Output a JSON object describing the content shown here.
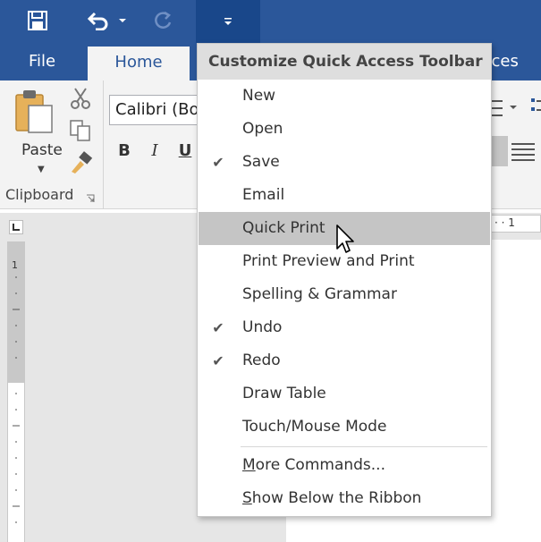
{
  "qat": {
    "save_icon": "save-icon",
    "undo_icon": "undo-icon",
    "redo_icon": "redo-icon",
    "customize_icon": "customize-dropdown-icon"
  },
  "tabs": {
    "file": "File",
    "home": "Home",
    "references_partial": "rences"
  },
  "ribbon": {
    "paste_label": "Paste",
    "clipboard_label": "Clipboard",
    "font_name": "Calibri (Bod",
    "bold": "B",
    "italic": "I",
    "underline": "U"
  },
  "ruler": {
    "top_mark": "· · 1",
    "left_mark": "1"
  },
  "menu": {
    "title": "Customize Quick Access Toolbar",
    "items": [
      {
        "label": "New",
        "checked": false
      },
      {
        "label": "Open",
        "checked": false
      },
      {
        "label": "Save",
        "checked": true
      },
      {
        "label": "Email",
        "checked": false
      },
      {
        "label": "Quick Print",
        "checked": false,
        "highlighted": true
      },
      {
        "label": "Print Preview and Print",
        "checked": false
      },
      {
        "label": "Spelling & Grammar",
        "checked": false
      },
      {
        "label": "Undo",
        "checked": true
      },
      {
        "label": "Redo",
        "checked": true
      },
      {
        "label": "Draw Table",
        "checked": false
      },
      {
        "label": "Touch/Mouse Mode",
        "checked": false
      }
    ],
    "more_commands": "More Commands...",
    "show_below": "Show Below the Ribbon",
    "check_glyph": "✔"
  },
  "colors": {
    "title_bar": "#2b579a",
    "customize_pressed": "#19478a",
    "ribbon_bg": "#f3f3f3",
    "menu_highlight": "#c5c5c5"
  }
}
